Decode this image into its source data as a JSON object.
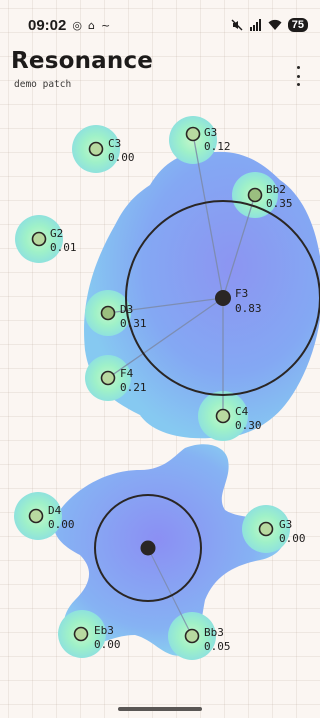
{
  "status_bar": {
    "time": "09:02",
    "icons_left": [
      "whirl-icon",
      "home-outline-icon",
      "squiggle-icon"
    ],
    "icons_right": [
      "mute-icon",
      "signal-icon",
      "wifi-icon"
    ],
    "battery": "75"
  },
  "header": {
    "title": "Resonance",
    "subtitle": "demo patch",
    "menu_icon": "more-vert-icon"
  },
  "colors": {
    "background": "#fbf6f2",
    "cell_blue": "#7f9bf5",
    "cell_edge": "#9cf0c2",
    "node_fill": "#b8d9a0",
    "hub": "#2a2624"
  },
  "cells": [
    {
      "hub": {
        "note": "F3",
        "value": "0.83"
      },
      "nodes": [
        {
          "note": "C3",
          "value": "0.00"
        },
        {
          "note": "G3",
          "value": "0.12"
        },
        {
          "note": "Bb2",
          "value": "0.35"
        },
        {
          "note": "G2",
          "value": "0.01"
        },
        {
          "note": "D3",
          "value": "0.31"
        },
        {
          "note": "F4",
          "value": "0.21"
        },
        {
          "note": "C4",
          "value": "0.30"
        }
      ]
    },
    {
      "hub": {
        "note": "",
        "value": ""
      },
      "nodes": [
        {
          "note": "D4",
          "value": "0.00"
        },
        {
          "note": "G3",
          "value": "0.00"
        },
        {
          "note": "Eb3",
          "value": "0.00"
        },
        {
          "note": "Bb3",
          "value": "0.05"
        }
      ]
    }
  ]
}
